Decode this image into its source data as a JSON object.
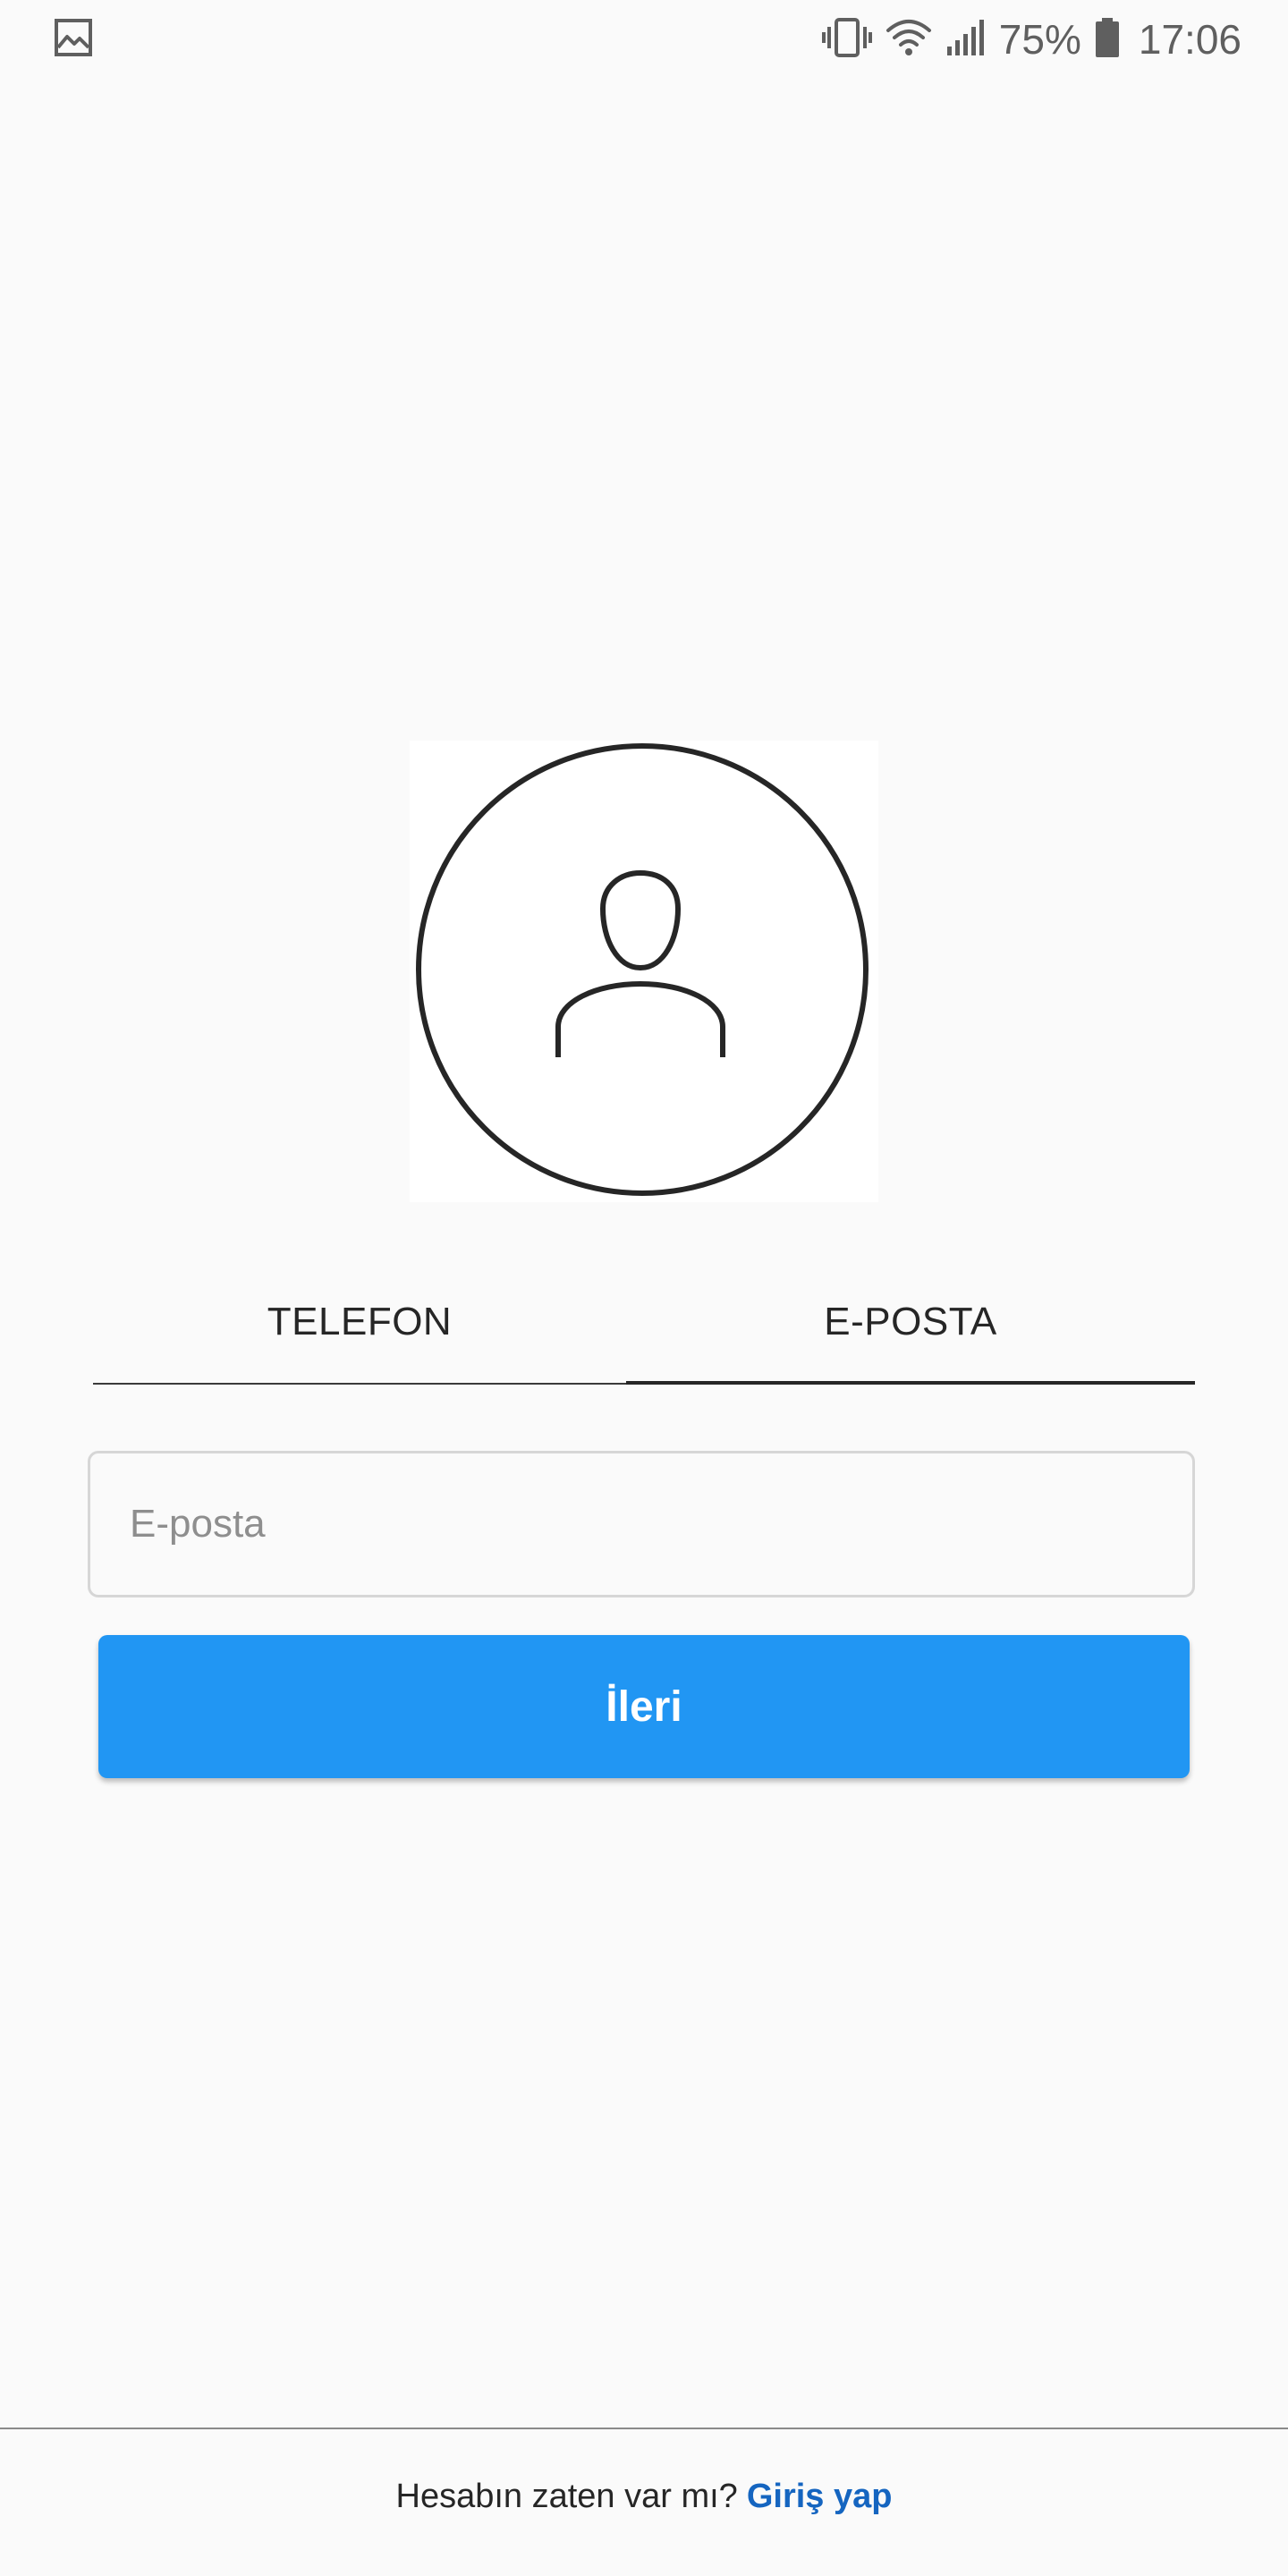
{
  "status_bar": {
    "battery_percent": "75%",
    "time": "17:06",
    "icons": [
      "image-icon",
      "vibrate-icon",
      "wifi-icon",
      "signal-icon",
      "battery-icon"
    ]
  },
  "tabs": [
    {
      "label": "TELEFON",
      "selected": false
    },
    {
      "label": "E-POSTA",
      "selected": true
    }
  ],
  "email_field": {
    "placeholder": "E-posta",
    "value": ""
  },
  "next_button": {
    "label": "İleri"
  },
  "footer": {
    "prompt": "Hesabın zaten var mı?",
    "login_link": "Giriş yap"
  },
  "colors": {
    "background": "#fafafa",
    "primary_button": "#2196f3",
    "link": "#1565c0",
    "text": "#262626"
  }
}
